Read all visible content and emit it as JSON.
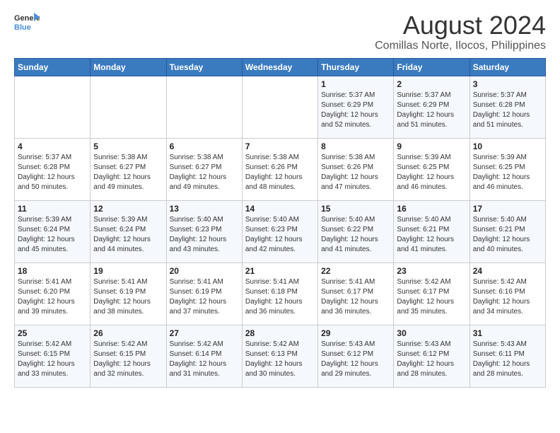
{
  "logo": {
    "line1": "General",
    "line2": "Blue"
  },
  "title": "August 2024",
  "location": "Comillas Norte, Ilocos, Philippines",
  "days_of_week": [
    "Sunday",
    "Monday",
    "Tuesday",
    "Wednesday",
    "Thursday",
    "Friday",
    "Saturday"
  ],
  "weeks": [
    [
      {
        "day": "",
        "info": ""
      },
      {
        "day": "",
        "info": ""
      },
      {
        "day": "",
        "info": ""
      },
      {
        "day": "",
        "info": ""
      },
      {
        "day": "1",
        "info": "Sunrise: 5:37 AM\nSunset: 6:29 PM\nDaylight: 12 hours\nand 52 minutes."
      },
      {
        "day": "2",
        "info": "Sunrise: 5:37 AM\nSunset: 6:29 PM\nDaylight: 12 hours\nand 51 minutes."
      },
      {
        "day": "3",
        "info": "Sunrise: 5:37 AM\nSunset: 6:28 PM\nDaylight: 12 hours\nand 51 minutes."
      }
    ],
    [
      {
        "day": "4",
        "info": "Sunrise: 5:37 AM\nSunset: 6:28 PM\nDaylight: 12 hours\nand 50 minutes."
      },
      {
        "day": "5",
        "info": "Sunrise: 5:38 AM\nSunset: 6:27 PM\nDaylight: 12 hours\nand 49 minutes."
      },
      {
        "day": "6",
        "info": "Sunrise: 5:38 AM\nSunset: 6:27 PM\nDaylight: 12 hours\nand 49 minutes."
      },
      {
        "day": "7",
        "info": "Sunrise: 5:38 AM\nSunset: 6:26 PM\nDaylight: 12 hours\nand 48 minutes."
      },
      {
        "day": "8",
        "info": "Sunrise: 5:38 AM\nSunset: 6:26 PM\nDaylight: 12 hours\nand 47 minutes."
      },
      {
        "day": "9",
        "info": "Sunrise: 5:39 AM\nSunset: 6:25 PM\nDaylight: 12 hours\nand 46 minutes."
      },
      {
        "day": "10",
        "info": "Sunrise: 5:39 AM\nSunset: 6:25 PM\nDaylight: 12 hours\nand 46 minutes."
      }
    ],
    [
      {
        "day": "11",
        "info": "Sunrise: 5:39 AM\nSunset: 6:24 PM\nDaylight: 12 hours\nand 45 minutes."
      },
      {
        "day": "12",
        "info": "Sunrise: 5:39 AM\nSunset: 6:24 PM\nDaylight: 12 hours\nand 44 minutes."
      },
      {
        "day": "13",
        "info": "Sunrise: 5:40 AM\nSunset: 6:23 PM\nDaylight: 12 hours\nand 43 minutes."
      },
      {
        "day": "14",
        "info": "Sunrise: 5:40 AM\nSunset: 6:23 PM\nDaylight: 12 hours\nand 42 minutes."
      },
      {
        "day": "15",
        "info": "Sunrise: 5:40 AM\nSunset: 6:22 PM\nDaylight: 12 hours\nand 41 minutes."
      },
      {
        "day": "16",
        "info": "Sunrise: 5:40 AM\nSunset: 6:21 PM\nDaylight: 12 hours\nand 41 minutes."
      },
      {
        "day": "17",
        "info": "Sunrise: 5:40 AM\nSunset: 6:21 PM\nDaylight: 12 hours\nand 40 minutes."
      }
    ],
    [
      {
        "day": "18",
        "info": "Sunrise: 5:41 AM\nSunset: 6:20 PM\nDaylight: 12 hours\nand 39 minutes."
      },
      {
        "day": "19",
        "info": "Sunrise: 5:41 AM\nSunset: 6:19 PM\nDaylight: 12 hours\nand 38 minutes."
      },
      {
        "day": "20",
        "info": "Sunrise: 5:41 AM\nSunset: 6:19 PM\nDaylight: 12 hours\nand 37 minutes."
      },
      {
        "day": "21",
        "info": "Sunrise: 5:41 AM\nSunset: 6:18 PM\nDaylight: 12 hours\nand 36 minutes."
      },
      {
        "day": "22",
        "info": "Sunrise: 5:41 AM\nSunset: 6:17 PM\nDaylight: 12 hours\nand 36 minutes."
      },
      {
        "day": "23",
        "info": "Sunrise: 5:42 AM\nSunset: 6:17 PM\nDaylight: 12 hours\nand 35 minutes."
      },
      {
        "day": "24",
        "info": "Sunrise: 5:42 AM\nSunset: 6:16 PM\nDaylight: 12 hours\nand 34 minutes."
      }
    ],
    [
      {
        "day": "25",
        "info": "Sunrise: 5:42 AM\nSunset: 6:15 PM\nDaylight: 12 hours\nand 33 minutes."
      },
      {
        "day": "26",
        "info": "Sunrise: 5:42 AM\nSunset: 6:15 PM\nDaylight: 12 hours\nand 32 minutes."
      },
      {
        "day": "27",
        "info": "Sunrise: 5:42 AM\nSunset: 6:14 PM\nDaylight: 12 hours\nand 31 minutes."
      },
      {
        "day": "28",
        "info": "Sunrise: 5:42 AM\nSunset: 6:13 PM\nDaylight: 12 hours\nand 30 minutes."
      },
      {
        "day": "29",
        "info": "Sunrise: 5:43 AM\nSunset: 6:12 PM\nDaylight: 12 hours\nand 29 minutes."
      },
      {
        "day": "30",
        "info": "Sunrise: 5:43 AM\nSunset: 6:12 PM\nDaylight: 12 hours\nand 28 minutes."
      },
      {
        "day": "31",
        "info": "Sunrise: 5:43 AM\nSunset: 6:11 PM\nDaylight: 12 hours\nand 28 minutes."
      }
    ]
  ]
}
